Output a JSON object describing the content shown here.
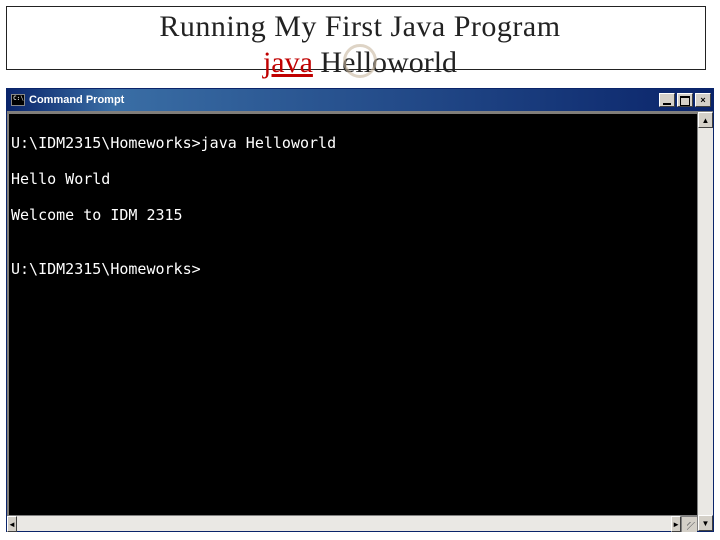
{
  "slide": {
    "title": "Running My First Java Program",
    "subtitle_java": "java",
    "subtitle_spacer": "    ",
    "subtitle_program": "Helloworld"
  },
  "cmd": {
    "window_title": "Command Prompt",
    "buttons": {
      "minimize": "minimize",
      "maximize": "maximize",
      "close": "×"
    },
    "lines": [
      "U:\\IDM2315\\Homeworks>java Helloworld",
      "Hello World",
      "Welcome to IDM 2315",
      "",
      "U:\\IDM2315\\Homeworks>"
    ],
    "scroll": {
      "up": "▲",
      "down": "▼",
      "left": "◄",
      "right": "►"
    }
  }
}
